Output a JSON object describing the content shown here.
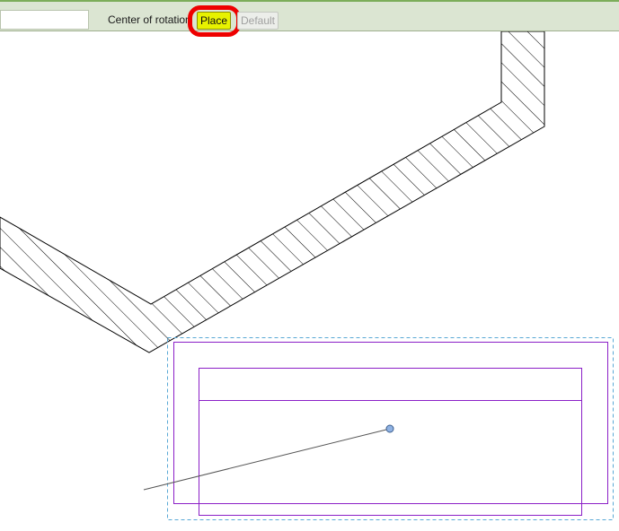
{
  "options_bar": {
    "center_of_rotation_label": "Center of rotation",
    "place_label": "Place",
    "default_label": "Default"
  },
  "colors": {
    "options_bar_bg": "#dbe5d2",
    "place_highlight": "#e7f200",
    "annotation_ring": "#ee0000",
    "selected_element": "#8b1fc7",
    "selection_box": "#5aa9d6",
    "rotation_center": "#8fb2e3"
  },
  "canvas": {
    "elements": [
      "hatched-wall",
      "selected-sofa",
      "selection-box",
      "rotation-center-handle",
      "rotation-guide-line"
    ]
  }
}
